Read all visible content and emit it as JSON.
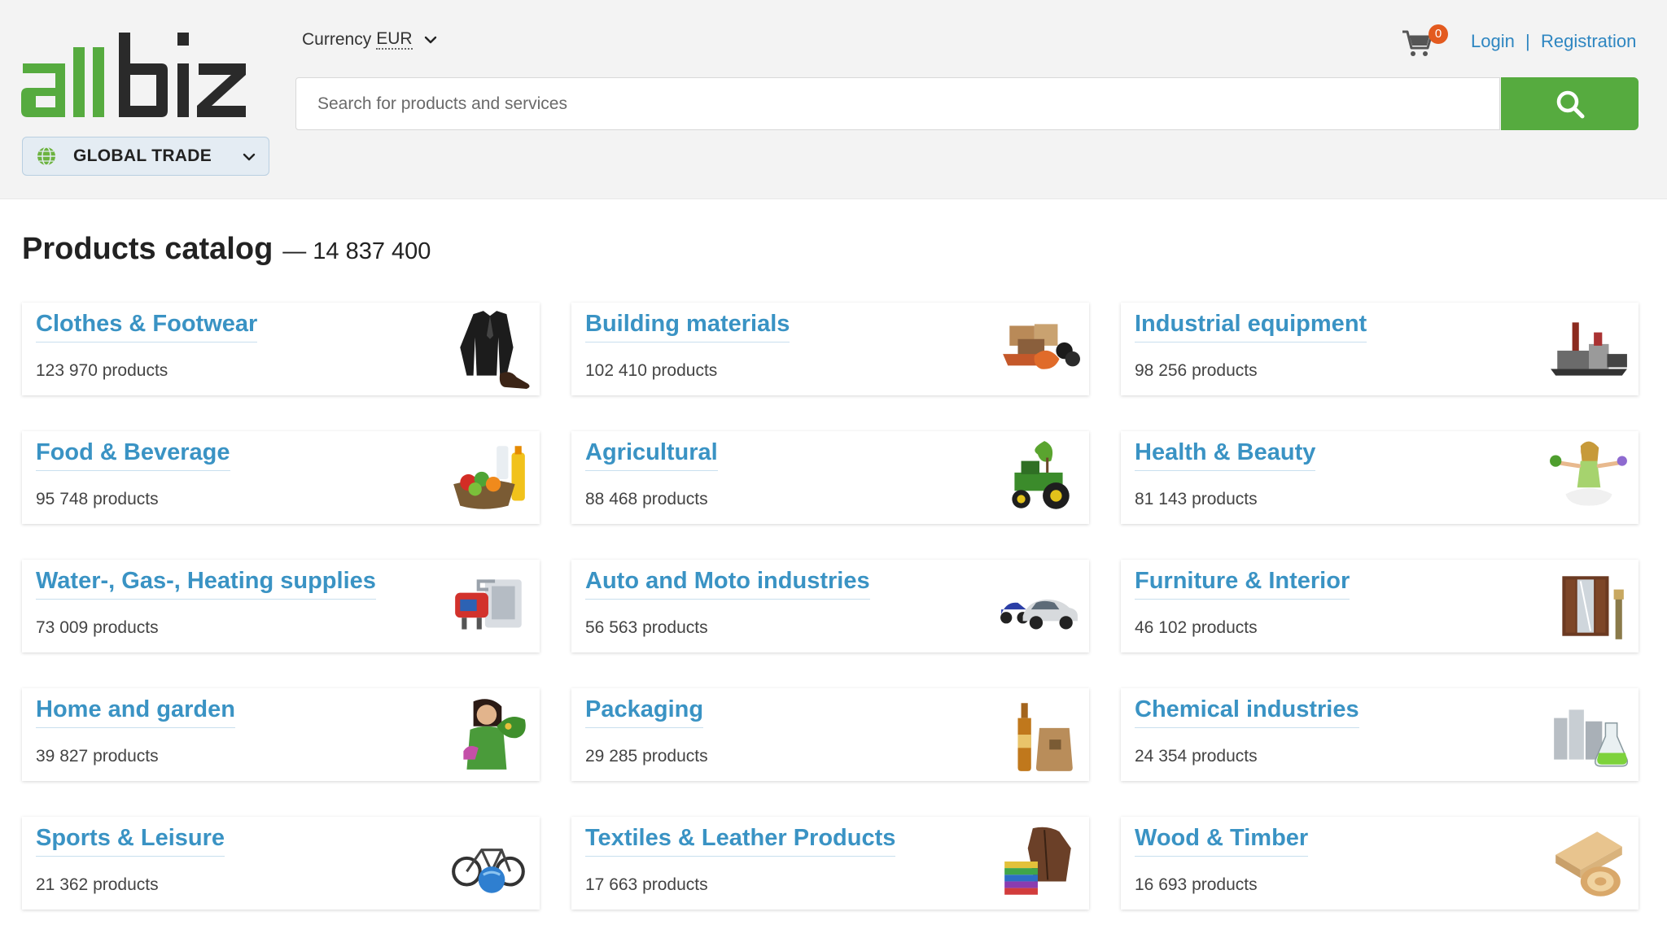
{
  "header": {
    "logo_text": "allbiz",
    "region_label": "GLOBAL TRADE",
    "currency_label": "Currency",
    "currency_code": "EUR",
    "search_placeholder": "Search for products and services",
    "cart_count": "0",
    "login": "Login",
    "separator": "|",
    "registration": "Registration"
  },
  "catalog": {
    "title": "Products catalog",
    "dash": "—",
    "total": "14 837 400",
    "categories": [
      {
        "name": "Clothes & Footwear",
        "count": "123 970 products",
        "icon": "clothes-icon"
      },
      {
        "name": "Building materials",
        "count": "102 410 products",
        "icon": "building-materials-icon"
      },
      {
        "name": "Industrial equipment",
        "count": "98 256 products",
        "icon": "industrial-equipment-icon"
      },
      {
        "name": "Food & Beverage",
        "count": "95 748 products",
        "icon": "food-icon"
      },
      {
        "name": "Agricultural",
        "count": "88 468 products",
        "icon": "tractor-icon"
      },
      {
        "name": "Health & Beauty",
        "count": "81 143 products",
        "icon": "yoga-woman-icon"
      },
      {
        "name": "Water-, Gas-, Heating supplies",
        "count": "73 009 products",
        "icon": "boiler-icon"
      },
      {
        "name": "Auto and Moto industries",
        "count": "56 563 products",
        "icon": "car-moto-icon"
      },
      {
        "name": "Furniture & Interior",
        "count": "46 102 products",
        "icon": "wardrobe-icon"
      },
      {
        "name": "Home and garden",
        "count": "39 827 products",
        "icon": "gardener-icon"
      },
      {
        "name": "Packaging",
        "count": "29 285 products",
        "icon": "bottle-bag-icon"
      },
      {
        "name": "Chemical industries",
        "count": "24 354 products",
        "icon": "chemical-plant-icon"
      },
      {
        "name": "Sports & Leisure",
        "count": "21 362 products",
        "icon": "bicycle-icon"
      },
      {
        "name": "Textiles & Leather Products",
        "count": "17 663 products",
        "icon": "textiles-icon"
      },
      {
        "name": "Wood & Timber",
        "count": "16 693 products",
        "icon": "wood-icon"
      }
    ]
  },
  "colors": {
    "brand_green": "#56ab3f",
    "link_blue": "#3a93c4",
    "badge_orange": "#e35a1f"
  }
}
